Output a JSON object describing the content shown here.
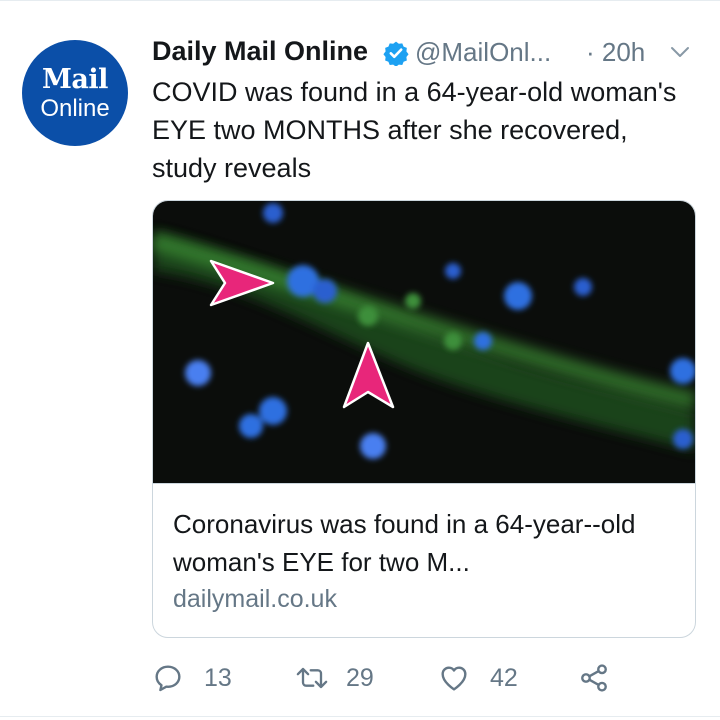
{
  "author": {
    "logo_line1": "Mail",
    "logo_line2": "Online",
    "name": "Daily Mail Online",
    "handle": "@MailOnl...",
    "time": "· 20h",
    "verified": true
  },
  "tweet": {
    "text": "COVID was found in a 64-year-old woman's EYE two MONTHS after she recovered, study reveals"
  },
  "card": {
    "title": "Coronavirus was found in a 64-year--old woman's EYE for two M...",
    "domain": "dailymail.co.uk"
  },
  "actions": {
    "reply_count": "13",
    "retweet_count": "29",
    "like_count": "42"
  },
  "colors": {
    "brand": "#0b4fa8",
    "verified": "#1da1f2",
    "muted": "#657786",
    "arrow": "#e8267a"
  }
}
